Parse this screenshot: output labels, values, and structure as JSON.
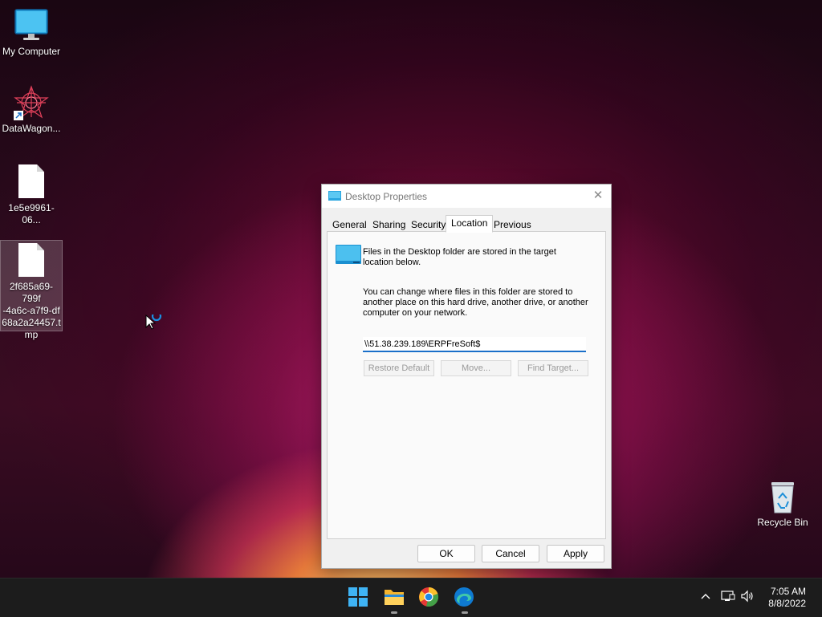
{
  "desktop": {
    "icons": [
      {
        "label": "My Computer"
      },
      {
        "label": "DataWagon..."
      },
      {
        "label": "1e5e9961-06..."
      },
      {
        "label_lines": [
          "2f685a69-799f",
          "-4a6c-a7f9-df",
          "68a2a24457.t",
          "mp"
        ]
      },
      {
        "label": "Recycle Bin"
      }
    ]
  },
  "dialog": {
    "title": "Desktop Properties",
    "tabs": [
      "General",
      "Sharing",
      "Security",
      "Location",
      "Previous Versions"
    ],
    "active_tab": "Location",
    "text1_lines": [
      "Files in the Desktop folder are stored in the target",
      "location below."
    ],
    "text2_lines": [
      "You can change where files in this folder are stored to",
      "another place on this hard drive, another drive, or another",
      "computer on your network."
    ],
    "path_value": "\\\\51.38.239.189\\ERPFreSoft$",
    "buttons": {
      "restore_default": "Restore Default",
      "move": "Move...",
      "find_target": "Find Target...",
      "ok": "OK",
      "cancel": "Cancel",
      "apply": "Apply"
    }
  },
  "taskbar": {
    "apps": [
      "start-icon",
      "file-explorer-icon",
      "chrome-icon",
      "edge-icon"
    ],
    "clock": {
      "time": "7:05 AM",
      "date": "8/8/2022"
    }
  },
  "colors": {
    "accent": "#1a6fc9",
    "taskbar_bg": "#1c1c1c",
    "dialog_bg": "#f0f0f0"
  }
}
